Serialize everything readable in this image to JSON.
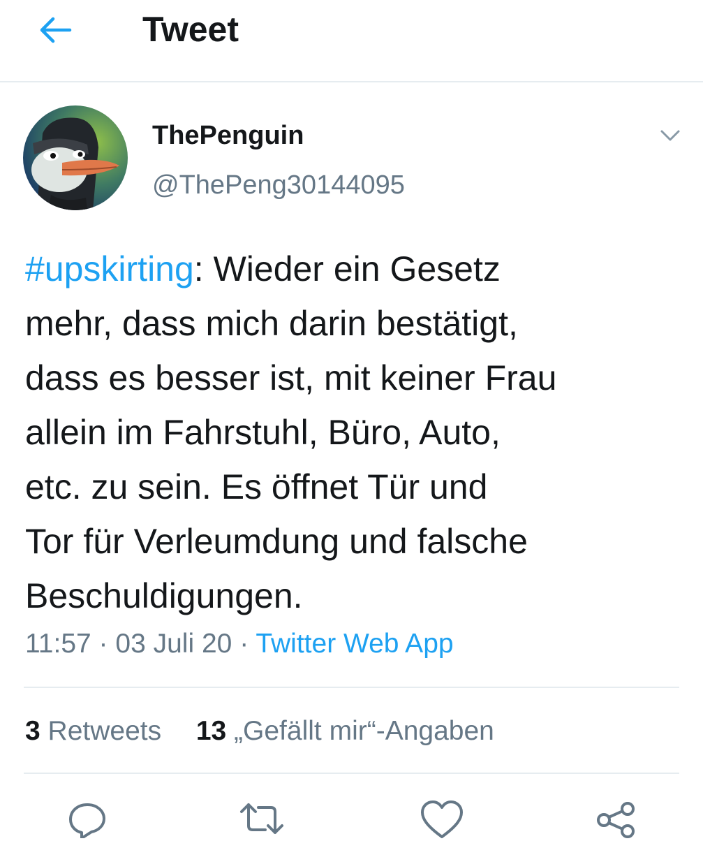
{
  "header": {
    "title": "Tweet",
    "back_icon": "arrow-left-icon"
  },
  "author": {
    "display_name": "ThePenguin",
    "handle": "@ThePeng30144095",
    "avatar": "penguin-avatar"
  },
  "tweet": {
    "hashtag": "#upskirting",
    "body": ": Wieder ein Gesetz\nmehr, dass mich darin bestätigt,\ndass es besser ist, mit keiner Frau\nallein im Fahrstuhl, Büro, Auto,\netc. zu sein. Es öffnet Tür und\nTor für Verleumdung und falsche\nBeschuldigungen.",
    "time": "11:57",
    "date": "03 Juli 20",
    "separator": "·",
    "source": "Twitter Web App"
  },
  "stats": {
    "retweets_count": "3",
    "retweets_label": "Retweets",
    "likes_count": "13",
    "likes_label": "„Gefällt mir“-Angaben"
  },
  "actions": [
    "reply-icon",
    "retweet-icon",
    "like-icon",
    "share-icon"
  ],
  "colors": {
    "accent": "#1da1f2",
    "text": "#14171a",
    "secondary": "#657786",
    "divider": "#e6ecf0"
  }
}
